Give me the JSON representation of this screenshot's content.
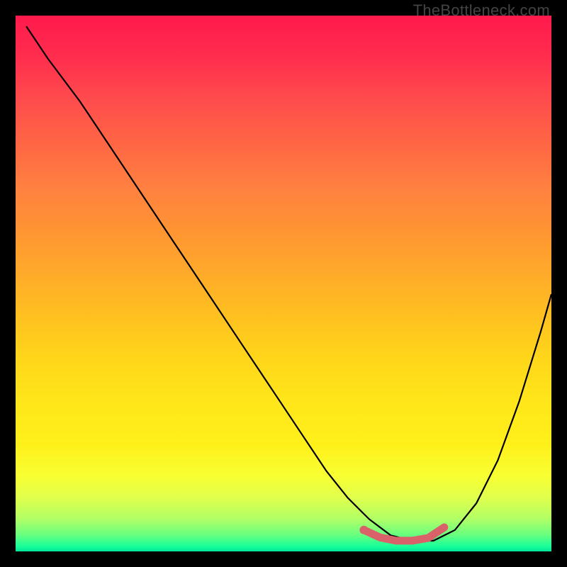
{
  "watermark": "TheBottleneck.com",
  "colors": {
    "frame": "#000000",
    "curve": "#000000",
    "marker": "#d9626a",
    "gradient_top": "#ff1a4d",
    "gradient_bottom": "#00e699"
  },
  "chart_data": {
    "type": "line",
    "title": "",
    "xlabel": "",
    "ylabel": "",
    "xlim": [
      0,
      100
    ],
    "ylim": [
      0,
      100
    ],
    "grid": false,
    "legend": false,
    "series": [
      {
        "name": "bottleneck-curve",
        "x": [
          2,
          6,
          12,
          18,
          24,
          30,
          36,
          42,
          48,
          54,
          58,
          62,
          66,
          70,
          74,
          78,
          82,
          86,
          90,
          94,
          98,
          100
        ],
        "y": [
          98,
          92,
          84,
          75,
          66,
          57,
          48,
          39,
          30,
          21,
          15,
          10,
          6,
          3,
          2,
          2,
          4,
          9,
          17,
          28,
          41,
          48
        ]
      }
    ],
    "markers": {
      "name": "optimal-range",
      "x": [
        65,
        68,
        71,
        74,
        77,
        80
      ],
      "y": [
        4.0,
        2.6,
        2.0,
        2.0,
        2.5,
        4.5
      ]
    }
  }
}
